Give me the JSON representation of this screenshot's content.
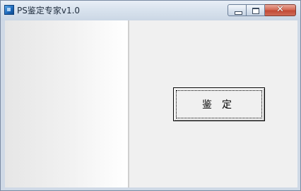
{
  "window": {
    "title": "PS鉴定专家v1.0"
  },
  "caption_buttons": {
    "minimize_icon": "minimize-icon",
    "maximize_icon": "maximize-icon",
    "close_glyph": "✕"
  },
  "main": {
    "identify_button_label": "鉴定"
  },
  "colors": {
    "titlebar": "#d9e3ee",
    "close_button": "#c24a35",
    "client_background": "#f0f0f0"
  }
}
